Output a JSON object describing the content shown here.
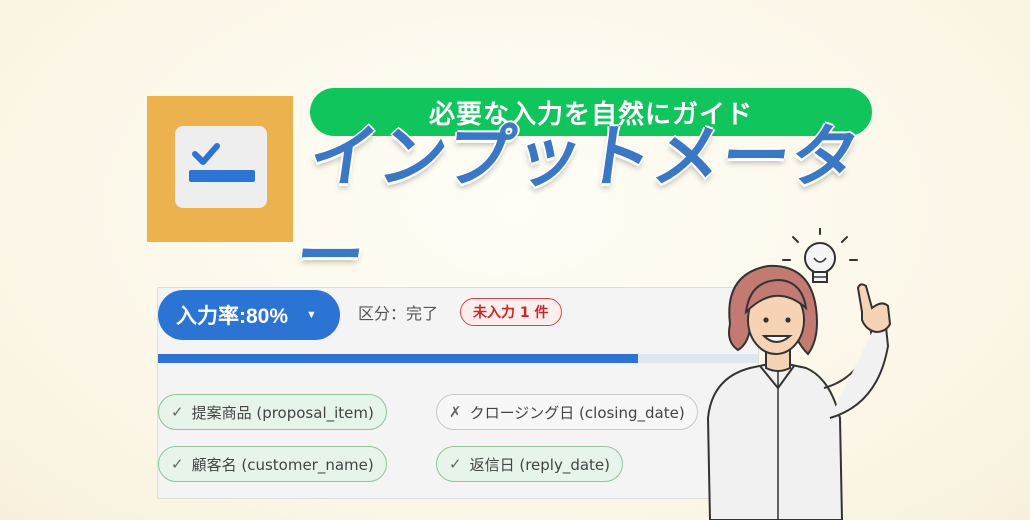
{
  "header": {
    "tagline": "必要な入力を自然にガイド",
    "title": "インプットメーター"
  },
  "logo": {
    "icon": "checklist-icon",
    "tile_color": "#ecb24e"
  },
  "meter": {
    "rate_label": "入力率:80%",
    "rate_caret": "▼",
    "rate_value": 0.8,
    "status_text": "区分：完了",
    "missing_badge": "未入力 1 件"
  },
  "fields": [
    {
      "mark": "✓",
      "label": "提案商品 (proposal_item)",
      "state": "done"
    },
    {
      "mark": "✗",
      "label": "クロージング日 (closing_date)",
      "state": "todo"
    },
    {
      "mark": "✓",
      "label": "顧客名 (customer_name)",
      "state": "done"
    },
    {
      "mark": "✓",
      "label": "返信日 (reply_date)",
      "state": "done"
    }
  ],
  "colors": {
    "tagline_bg": "#0fc55c",
    "title": "#3a78c5",
    "accent_blue": "#2c74d4",
    "badge_red": "#d64545"
  },
  "illustration": "woman-with-lightbulb-idea"
}
